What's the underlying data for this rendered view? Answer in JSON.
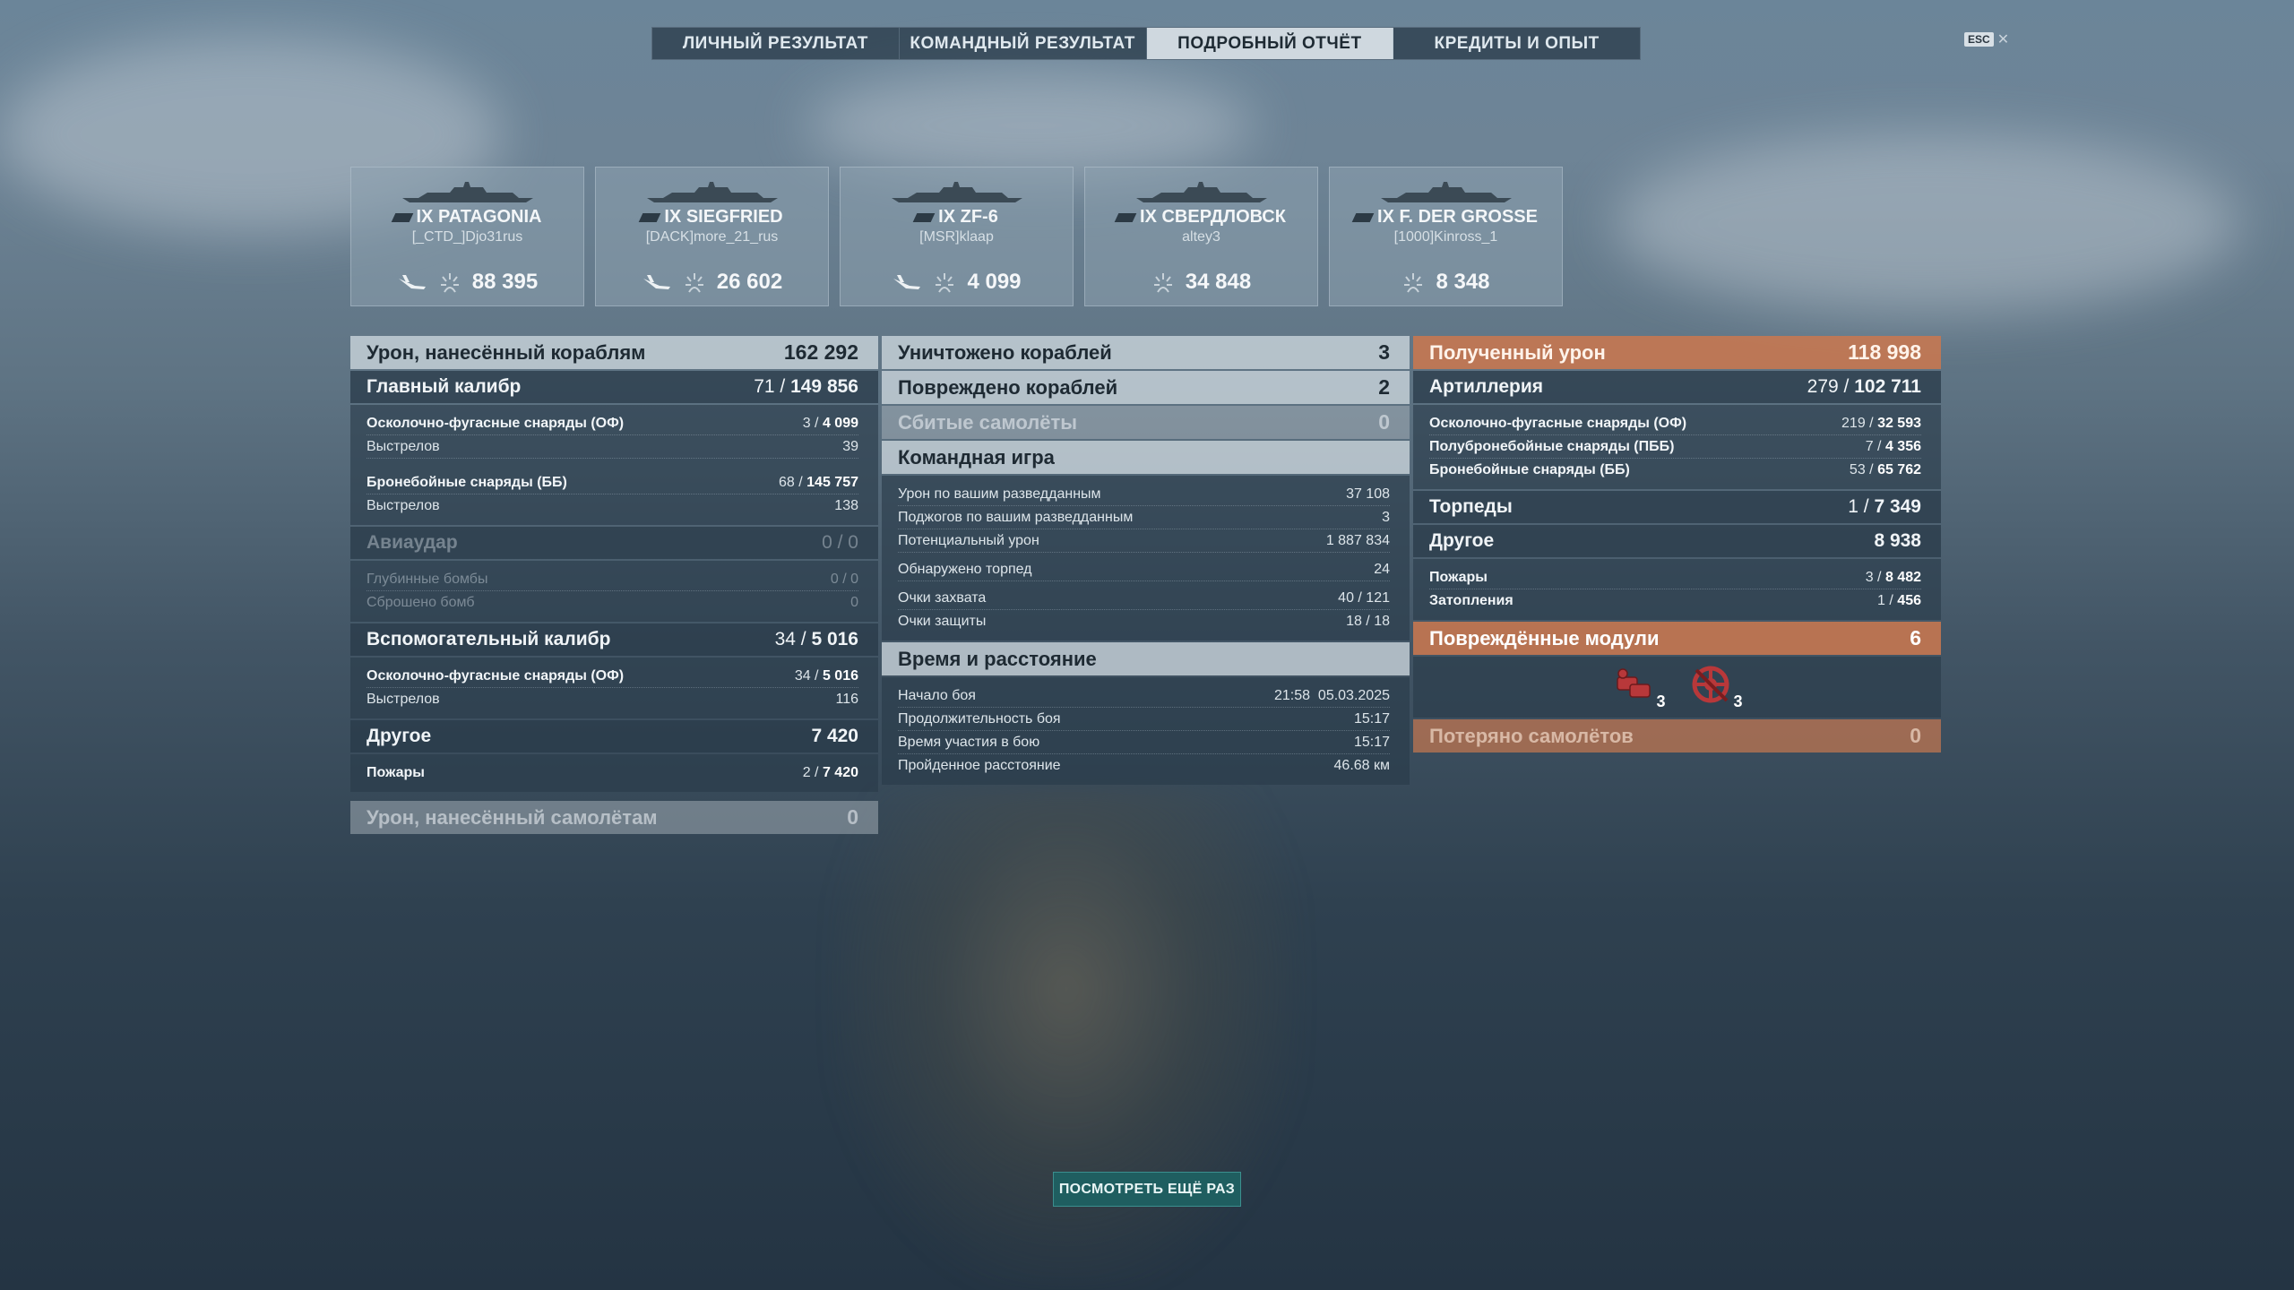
{
  "tabs": [
    {
      "label": "ЛИЧНЫЙ РЕЗУЛЬТАТ"
    },
    {
      "label": "КОМАНДНЫЙ РЕЗУЛЬТАТ"
    },
    {
      "label": "ПОДРОБНЫЙ ОТЧЁТ"
    },
    {
      "label": "КРЕДИТЫ И ОПЫТ"
    }
  ],
  "active_tab": 2,
  "esc_label": "ESC",
  "ships": [
    {
      "name": "IX PATAGONIA",
      "player": "[_CTD_]Djo31rus",
      "damage": "88 395",
      "has_plane": true
    },
    {
      "name": "IX SIEGFRIED",
      "player": "[DACK]more_21_rus",
      "damage": "26 602",
      "has_plane": true
    },
    {
      "name": "IX ZF-6",
      "player": "[MSR]klaap",
      "damage": "4 099",
      "has_plane": true
    },
    {
      "name": "IX СВЕРДЛОВСК",
      "player": "altey3",
      "damage": "34 848",
      "has_plane": false
    },
    {
      "name": "IX F. DER GROSSE",
      "player": "[1000]Kinross_1",
      "damage": "8 348",
      "has_plane": false
    }
  ],
  "col1": {
    "dealt": {
      "label": "Урон, нанесённый кораблям",
      "value": "162 292"
    },
    "main": {
      "label": "Главный калибр",
      "hits": "71",
      "dmg": "149 856"
    },
    "he_label": "Осколочно-фугасные снаряды (ОФ)",
    "he_hits": "3",
    "he_dmg": "4 099",
    "he_shots_label": "Выстрелов",
    "he_shots": "39",
    "ap_label": "Бронебойные снаряды (ББ)",
    "ap_hits": "68",
    "ap_dmg": "145 757",
    "ap_shots_label": "Выстрелов",
    "ap_shots": "138",
    "air": {
      "label": "Авиаудар",
      "value": "0 / 0"
    },
    "depth_label": "Глубинные бомбы",
    "depth_value": "0 / 0",
    "bombs_label": "Сброшено бомб",
    "bombs_value": "0",
    "sec": {
      "label": "Вспомогательный калибр",
      "hits": "34",
      "dmg": "5 016"
    },
    "sec_he_label": "Осколочно-фугасные снаряды (ОФ)",
    "sec_he_hits": "34",
    "sec_he_dmg": "5 016",
    "sec_shots_label": "Выстрелов",
    "sec_shots": "116",
    "other": {
      "label": "Другое",
      "value": "7 420"
    },
    "fires_label": "Пожары",
    "fires_hits": "2",
    "fires_dmg": "7 420",
    "planes": {
      "label": "Урон, нанесённый самолётам",
      "value": "0"
    }
  },
  "col2": {
    "destroyed": {
      "label": "Уничтожено кораблей",
      "value": "3"
    },
    "damaged": {
      "label": "Повреждено кораблей",
      "value": "2"
    },
    "shot_down": {
      "label": "Сбитые самолёты",
      "value": "0"
    },
    "team": {
      "label": "Командная игра"
    },
    "team_rows": [
      {
        "label": "Урон по вашим разведданным",
        "value": "37 108"
      },
      {
        "label": "Поджогов по вашим разведданным",
        "value": "3"
      },
      {
        "label": "Потенциальный урон",
        "value": "1 887 834"
      }
    ],
    "torp_spotted_label": "Обнаружено торпед",
    "torp_spotted": "24",
    "cap_rows": [
      {
        "label": "Очки захвата",
        "value": "40 / 121"
      },
      {
        "label": "Очки защиты",
        "value": "18 / 18"
      }
    ],
    "time": {
      "label": "Время и расстояние"
    },
    "time_rows": [
      {
        "label": "Начало боя",
        "value": "21:58  05.03.2025"
      },
      {
        "label": "Продолжительность боя",
        "value": "15:17"
      },
      {
        "label": "Время участия в бою",
        "value": "15:17"
      },
      {
        "label": "Пройденное расстояние",
        "value": "46.68 км"
      }
    ]
  },
  "col3": {
    "received": {
      "label": "Полученный урон",
      "value": "118 998"
    },
    "artillery": {
      "label": "Артиллерия",
      "hits": "279",
      "dmg": "102 711"
    },
    "art_rows": [
      {
        "label": "Осколочно-фугасные снаряды (ОФ)",
        "hits": "219",
        "dmg": "32 593"
      },
      {
        "label": "Полубронебойные снаряды (ПББ)",
        "hits": "7",
        "dmg": "4 356"
      },
      {
        "label": "Бронебойные снаряды (ББ)",
        "hits": "53",
        "dmg": "65 762"
      }
    ],
    "torpedoes": {
      "label": "Торпеды",
      "hits": "1",
      "dmg": "7 349"
    },
    "other": {
      "label": "Другое",
      "value": "8 938"
    },
    "other_rows": [
      {
        "label": "Пожары",
        "hits": "3",
        "dmg": "8 482"
      },
      {
        "label": "Затопления",
        "hits": "1",
        "dmg": "456"
      }
    ],
    "modules": {
      "label": "Повреждённые модули",
      "value": "6"
    },
    "module_icons": [
      {
        "icon": "engine-module-icon",
        "count": "3"
      },
      {
        "icon": "steering-module-icon",
        "count": "3"
      }
    ],
    "planes_lost": {
      "label": "Потеряно самолётов",
      "value": "0"
    }
  },
  "replay_label": "ПОСМОТРЕТЬ ЕЩЁ РАЗ"
}
